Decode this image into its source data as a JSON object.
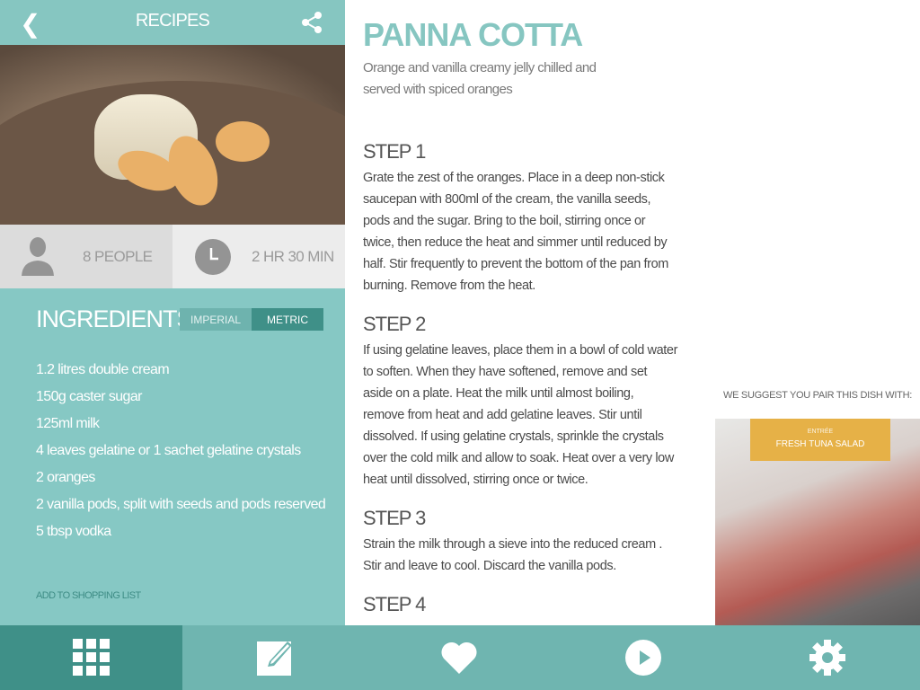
{
  "header": {
    "title": "RECIPES",
    "back_icon": "chevron-left-icon",
    "share_icon": "share-icon"
  },
  "info": {
    "servings": "8 PEOPLE",
    "time": "2 HR 30 MIN"
  },
  "ingredients": {
    "title": "INGREDIENTS",
    "units": {
      "imperial": "IMPERIAL",
      "metric": "METRIC",
      "selected": "metric"
    },
    "items": [
      "1.2 litres double cream",
      "150g caster sugar",
      "125ml milk",
      "4 leaves gelatine or 1 sachet gelatine crystals",
      "2 oranges",
      "2 vanilla pods, split with seeds and pods reserved",
      "5 tbsp vodka"
    ],
    "shopping_link": "ADD TO SHOPPING LIST"
  },
  "recipe": {
    "title": "PANNA COTTA",
    "subtitle": "Orange and vanilla creamy jelly chilled and served with spiced oranges",
    "steps": [
      {
        "title": "STEP 1",
        "text": "Grate the zest of the oranges. Place in a deep non-stick saucepan with 800ml  of the cream, the vanilla seeds, pods and the sugar. Bring to the boil, stirring once or twice, then reduce the heat and simmer until reduced by half. Stir frequently to prevent the bottom of the pan from burning. Remove from the heat."
      },
      {
        "title": "STEP 2",
        "text": "If using gelatine leaves, place them in a bowl of cold water to soften. When they have softened, remove and set aside on a plate. Heat the milk until almost boiling, remove from heat and add gelatine leaves. Stir until dissolved. If using gelatine crystals, sprinkle the crystals over the cold milk and allow to soak. Heat over a very low heat until dissolved, stirring once or twice."
      },
      {
        "title": "STEP 3",
        "text": "Strain the milk through a sieve into the reduced cream . Stir and leave to cool. Discard the vanilla pods."
      },
      {
        "title": "STEP 4"
      }
    ]
  },
  "pairing": {
    "label": "WE SUGGEST YOU PAIR THIS  DISH WITH:",
    "category": "ENTRÉE",
    "dish": "FRESH TUNA SALAD"
  },
  "tabbar": {
    "items": [
      "grid-icon",
      "edit-icon",
      "heart-icon",
      "play-icon",
      "gear-icon"
    ],
    "active": 0
  },
  "colors": {
    "accent": "#86c6c1",
    "dark": "#3f9088",
    "tab": "#6fb5b0",
    "pairing": "#e6b147"
  }
}
